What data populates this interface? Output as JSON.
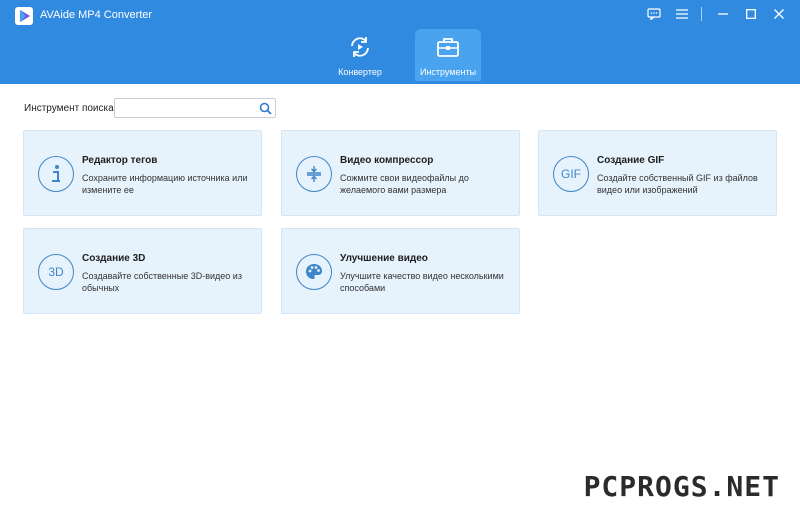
{
  "window": {
    "title": "AVAide MP4 Converter",
    "icons": [
      "feedback-icon",
      "menu-icon",
      "minimize-icon",
      "maximize-icon",
      "close-icon"
    ]
  },
  "colors": {
    "header": "#2f8ae0",
    "active_tab": "#4aa3ef",
    "card_bg": "#e6f2fc",
    "icon_accent": "#3e86c8"
  },
  "tabs": [
    {
      "label": "Конвертер",
      "icon": "convert-icon",
      "active": false
    },
    {
      "label": "Инструменты",
      "icon": "toolbox-icon",
      "active": true
    }
  ],
  "search": {
    "label": "Инструмент поиска:",
    "value": "",
    "placeholder": ""
  },
  "tools": [
    {
      "title": "Редактор тегов",
      "desc": "Сохраните информацию источника или измените ее",
      "icon": "info-icon"
    },
    {
      "title": "Видео компрессор",
      "desc": "Сожмите свои видеофайлы до желаемого вами размера",
      "icon": "compress-icon"
    },
    {
      "title": "Создание GIF",
      "desc": "Создайте собственный GIF из файлов видео или изображений",
      "icon": "gif-icon",
      "icon_text": "GIF"
    },
    {
      "title": "Создание 3D",
      "desc": "Создавайте собственные 3D-видео из обычных",
      "icon": "3d-icon",
      "icon_text": "3D"
    },
    {
      "title": "Улучшение видео",
      "desc": "Улучшите качество видео несколькими способами",
      "icon": "palette-icon"
    }
  ],
  "watermark": "PCPROGS.NET"
}
